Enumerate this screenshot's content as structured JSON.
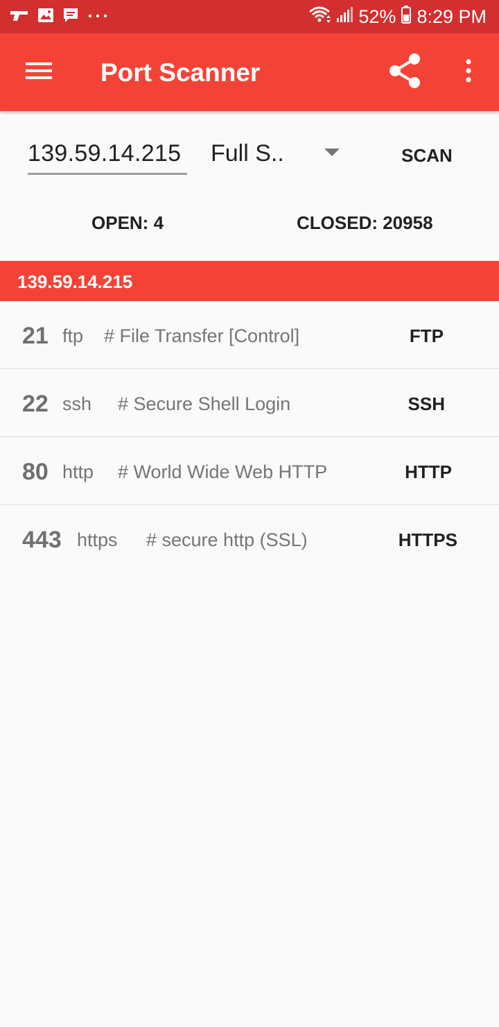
{
  "status_bar": {
    "battery": "52%",
    "time": "8:29 PM",
    "left_icons": [
      "gun-icon",
      "image-icon",
      "chat-icon",
      "more-notifications-icon"
    ],
    "right_icons": [
      "wifi-icon",
      "signal-icon",
      "battery-icon"
    ]
  },
  "app_bar": {
    "title": "Port Scanner",
    "background": "#f44336",
    "status_background": "#d32f2f"
  },
  "form": {
    "host_value": "139.59.14.215",
    "scan_type_value": "Full S..",
    "scan_label": "SCAN"
  },
  "summary": {
    "open_label": "OPEN: 4",
    "closed_label": "CLOSED: 20958"
  },
  "result": {
    "host_header": "139.59.14.215",
    "ports": [
      {
        "number": "21",
        "proto": "ftp",
        "desc": "# File Transfer [Control]",
        "service": "FTP"
      },
      {
        "number": "22",
        "proto": "ssh",
        "desc": "# Secure Shell Login",
        "service": "SSH"
      },
      {
        "number": "80",
        "proto": "http",
        "desc": "# World Wide Web HTTP",
        "service": "HTTP"
      },
      {
        "number": "443",
        "proto": "https",
        "desc": "# secure http (SSL)",
        "service": "HTTPS"
      }
    ]
  }
}
